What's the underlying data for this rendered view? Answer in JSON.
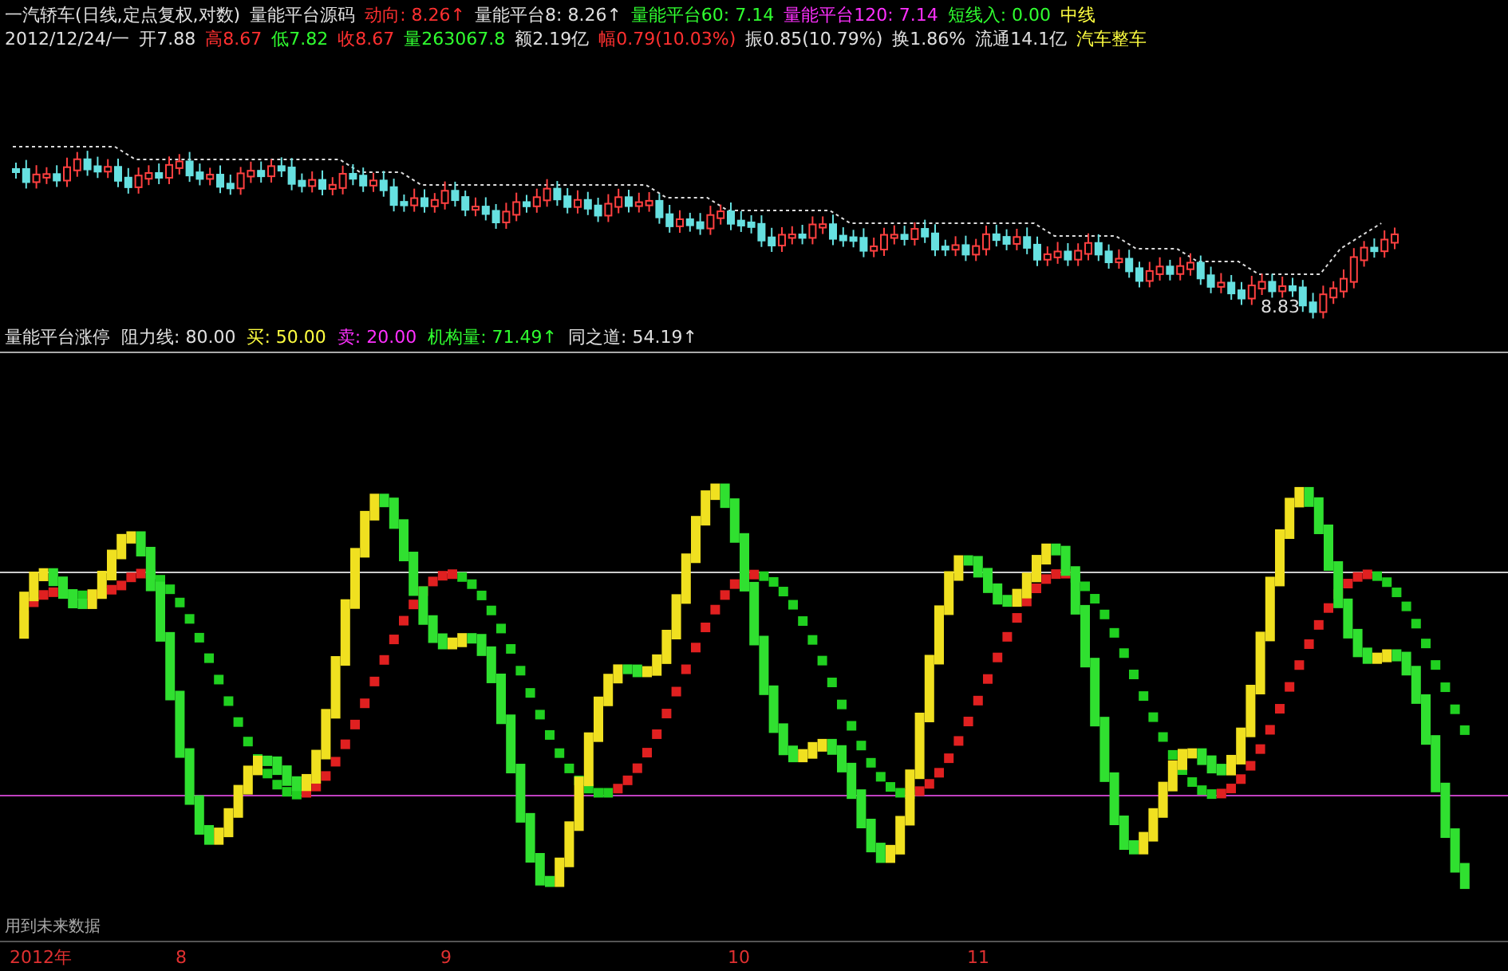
{
  "quote_header": {
    "line_1": [
      {
        "text": "一汽轿车(日线,定点复权,对数)",
        "color": "#e0e0e0"
      },
      {
        "text": "量能平台源码",
        "color": "#e0e0e0"
      },
      {
        "text": "动向: 8.26↑",
        "color": "#ff3030"
      },
      {
        "text": "量能平台8: 8.26↑",
        "color": "#e0e0e0"
      },
      {
        "text": "量能平台60: 7.14",
        "color": "#30ff30"
      },
      {
        "text": "量能平台120: 7.14",
        "color": "#ff30ff"
      },
      {
        "text": "短线入: 0.00",
        "color": "#30ff30"
      },
      {
        "text": "中线",
        "color": "#ffff40"
      }
    ],
    "line_2": [
      {
        "text": "2012/12/24/一",
        "color": "#e0e0e0"
      },
      {
        "text": "开7.88",
        "color": "#e0e0e0"
      },
      {
        "text": "高8.67",
        "color": "#ff3030"
      },
      {
        "text": "低7.82",
        "color": "#30ff30"
      },
      {
        "text": "收8.67",
        "color": "#ff3030"
      },
      {
        "text": "量263067.8",
        "color": "#30ff30"
      },
      {
        "text": "额2.19亿",
        "color": "#e0e0e0"
      },
      {
        "text": "幅0.79(10.03%)",
        "color": "#ff3030"
      },
      {
        "text": "振0.85(10.79%)",
        "color": "#e0e0e0"
      },
      {
        "text": "换1.86%",
        "color": "#e0e0e0"
      },
      {
        "text": "流通14.1亿",
        "color": "#e0e0e0"
      },
      {
        "text": "汽车整车",
        "color": "#ffff40"
      }
    ]
  },
  "price_chart": {
    "low_label": "8.83"
  },
  "indicator_header": [
    {
      "text": "量能平台涨停",
      "color": "#e0e0e0"
    },
    {
      "text": "阻力线: 80.00",
      "color": "#e0e0e0"
    },
    {
      "text": "买: 50.00",
      "color": "#ffff40"
    },
    {
      "text": "卖: 20.00",
      "color": "#ff30ff"
    },
    {
      "text": "机构量: 71.49↑",
      "color": "#30ff30"
    },
    {
      "text": "同之道: 54.19↑",
      "color": "#e0e0e0"
    }
  ],
  "indicator_note": "用到未来数据",
  "time_axis": [
    "2012年",
    "8",
    "9",
    "10",
    "11"
  ]
}
